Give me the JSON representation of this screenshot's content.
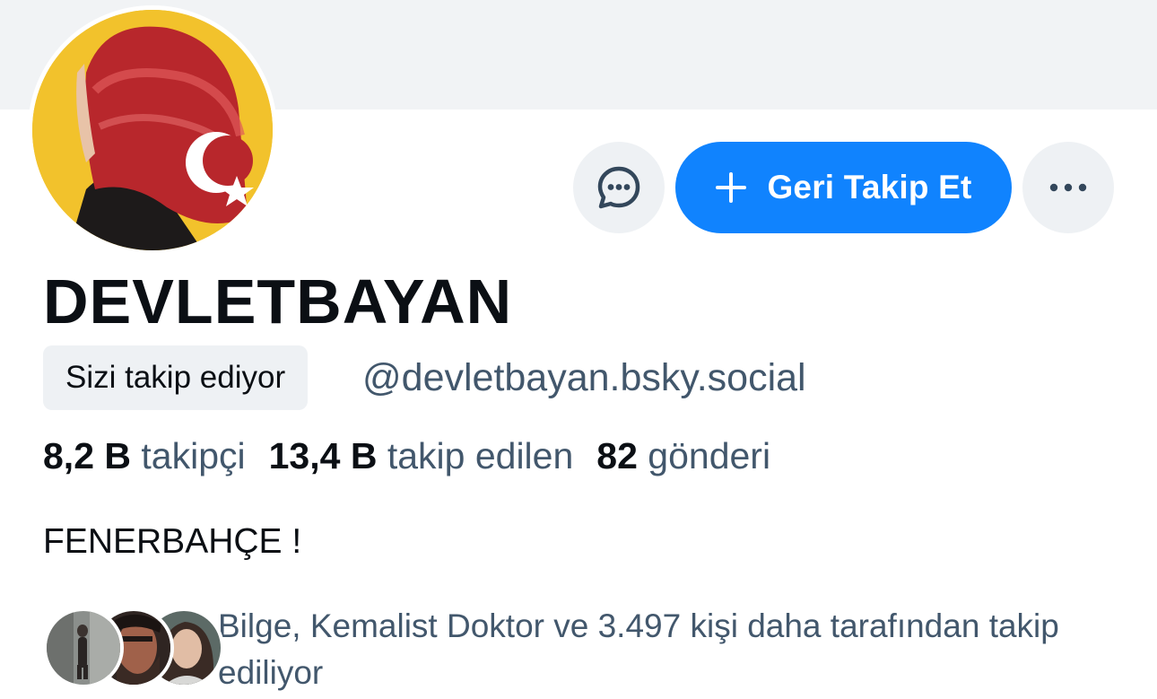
{
  "profile": {
    "display_name": "DEVLETBAYAN",
    "follows_you_badge": "Sizi takip ediyor",
    "handle": "@devletbayan.bsky.social",
    "bio": "FENERBAHÇE !"
  },
  "actions": {
    "message_icon": "chat-bubble-icon",
    "follow_back_label": "Geri Takip Et",
    "follow_icon": "plus-icon",
    "more_icon": "ellipsis-icon"
  },
  "stats": {
    "followers_count": "8,2 B",
    "followers_label": "takipçi",
    "following_count": "13,4 B",
    "following_label": "takip edilen",
    "posts_count": "82",
    "posts_label": "gönderi"
  },
  "known_followers": {
    "text": "Bilge, Kemalist Doktor ve 3.497 kişi daha tarafından takip ediliyor"
  },
  "colors": {
    "accent": "#1083fe",
    "banner": "#f1f3f5",
    "muted_text": "#42576c",
    "button_bg": "#eef1f4"
  }
}
